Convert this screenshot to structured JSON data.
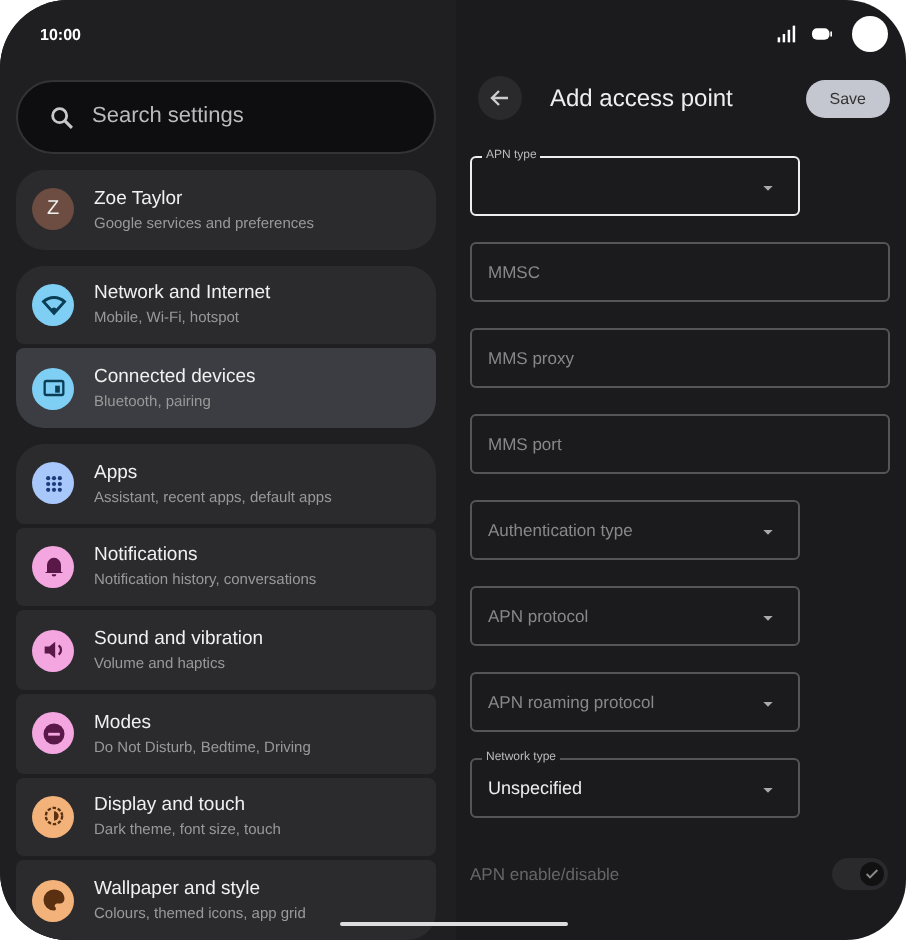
{
  "status_bar": {
    "time": "10:00"
  },
  "search": {
    "placeholder": "Search settings"
  },
  "settings_groups": [
    {
      "items": [
        {
          "title": "Zoe Taylor",
          "subtitle": "Google services and preferences",
          "kind": "avatar",
          "initial": "Z",
          "color": "#6d4c41"
        }
      ]
    },
    {
      "items": [
        {
          "title": "Network and Internet",
          "subtitle": "Mobile, Wi-Fi, hotspot",
          "kind": "icon",
          "color": "#7fcff5",
          "selected": false
        },
        {
          "title": "Connected devices",
          "subtitle": "Bluetooth, pairing",
          "kind": "icon",
          "color": "#7fcff5",
          "selected": true
        }
      ]
    },
    {
      "items": [
        {
          "title": "Apps",
          "subtitle": "Assistant, recent apps, default apps",
          "kind": "icon",
          "color": "#a8c7fa",
          "selected": false
        },
        {
          "title": "Notifications",
          "subtitle": "Notification history, conversations",
          "kind": "icon",
          "color": "#f3a6e0",
          "selected": false
        },
        {
          "title": "Sound and vibration",
          "subtitle": "Volume and haptics",
          "kind": "icon",
          "color": "#f3a6e0",
          "selected": false
        },
        {
          "title": "Modes",
          "subtitle": "Do Not Disturb, Bedtime, Driving",
          "kind": "icon",
          "color": "#f3a6e0",
          "selected": false
        },
        {
          "title": "Display and touch",
          "subtitle": "Dark theme, font size, touch",
          "kind": "icon",
          "color": "#f2b27a",
          "selected": false
        },
        {
          "title": "Wallpaper and style",
          "subtitle": "Colours, themed icons, app grid",
          "kind": "icon",
          "color": "#f2b27a",
          "selected": false
        }
      ]
    }
  ],
  "detail": {
    "title": "Add access point",
    "save_button": "Save",
    "fields": [
      {
        "kind": "dropdown",
        "label": "APN type",
        "floating": true,
        "focused": true
      },
      {
        "kind": "text",
        "label": "MMSC",
        "focused": false
      },
      {
        "kind": "text",
        "label": "MMS proxy",
        "focused": false
      },
      {
        "kind": "text",
        "label": "MMS port",
        "focused": false
      },
      {
        "kind": "dropdown",
        "label": "Authentication type",
        "focused": false
      },
      {
        "kind": "dropdown",
        "label": "APN protocol",
        "focused": false
      },
      {
        "kind": "dropdown",
        "label": "APN roaming protocol",
        "focused": false
      },
      {
        "kind": "dropdown",
        "label": "Network type",
        "value": "Unspecified",
        "focused": false
      }
    ],
    "toggle": {
      "label": "APN enable/disable",
      "on": true,
      "disabled": true
    }
  }
}
